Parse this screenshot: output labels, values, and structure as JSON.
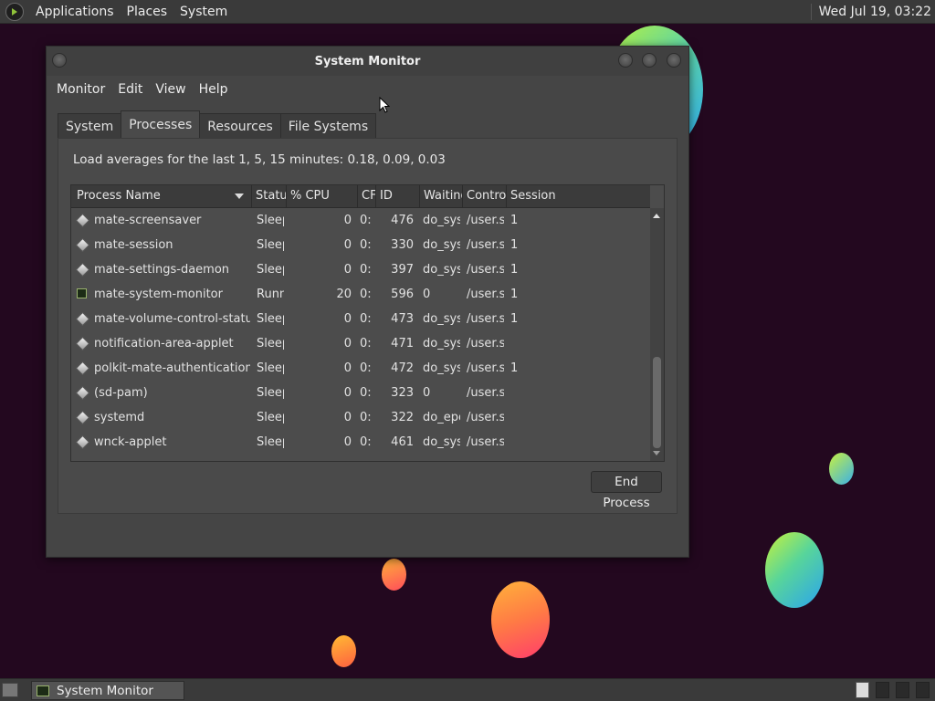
{
  "top_panel": {
    "menus": [
      "Applications",
      "Places",
      "System"
    ],
    "clock": "Wed Jul 19, 03:22"
  },
  "window": {
    "title": "System Monitor",
    "menus": [
      "Monitor",
      "Edit",
      "View",
      "Help"
    ],
    "tabs": [
      "System",
      "Processes",
      "Resources",
      "File Systems"
    ],
    "active_tab": "Processes",
    "load_averages": "Load averages for the last 1, 5, 15 minutes: 0.18, 0.09, 0.03",
    "columns": [
      "Process Name",
      "Statu",
      "% CPU",
      "CF",
      "ID",
      "Waiting",
      "Contro",
      "Session"
    ],
    "processes": [
      {
        "name": "mate-screensaver",
        "status": "Sleep",
        "cpu": "0",
        "cputime": "0:",
        "id": "476",
        "waiting": "do_sys",
        "control": "/user.s",
        "session": "1",
        "icon": "diamond-icon"
      },
      {
        "name": "mate-session",
        "status": "Sleep",
        "cpu": "0",
        "cputime": "0:",
        "id": "330",
        "waiting": "do_sys",
        "control": "/user.s",
        "session": "1",
        "icon": "diamond-icon"
      },
      {
        "name": "mate-settings-daemon",
        "status": "Sleep",
        "cpu": "0",
        "cputime": "0:",
        "id": "397",
        "waiting": "do_sys",
        "control": "/user.s",
        "session": "1",
        "icon": "diamond-icon"
      },
      {
        "name": "mate-system-monitor",
        "status": "Runn",
        "cpu": "20",
        "cputime": "0:",
        "id": "596",
        "waiting": "0",
        "control": "/user.s",
        "session": "1",
        "icon": "system-monitor-icon"
      },
      {
        "name": "mate-volume-control-status",
        "status": "Sleep",
        "cpu": "0",
        "cputime": "0:",
        "id": "473",
        "waiting": "do_sys",
        "control": "/user.s",
        "session": "1",
        "icon": "diamond-icon"
      },
      {
        "name": "notification-area-applet",
        "status": "Sleep",
        "cpu": "0",
        "cputime": "0:",
        "id": "471",
        "waiting": "do_sys",
        "control": "/user.s",
        "session": "",
        "icon": "diamond-icon"
      },
      {
        "name": "polkit-mate-authentication-",
        "status": "Sleep",
        "cpu": "0",
        "cputime": "0:",
        "id": "472",
        "waiting": "do_sys",
        "control": "/user.s",
        "session": "1",
        "icon": "diamond-icon"
      },
      {
        "name": "(sd-pam)",
        "status": "Sleep",
        "cpu": "0",
        "cputime": "0:",
        "id": "323",
        "waiting": "0",
        "control": "/user.s",
        "session": "",
        "icon": "diamond-icon"
      },
      {
        "name": "systemd",
        "status": "Sleep",
        "cpu": "0",
        "cputime": "0:",
        "id": "322",
        "waiting": "do_epo",
        "control": "/user.s",
        "session": "",
        "icon": "diamond-icon"
      },
      {
        "name": "wnck-applet",
        "status": "Sleep",
        "cpu": "0",
        "cputime": "0:",
        "id": "461",
        "waiting": "do_sys",
        "control": "/user.s",
        "session": "",
        "icon": "diamond-icon"
      }
    ],
    "end_process_label": "End Process"
  },
  "taskbar": {
    "items": [
      {
        "label": "System Monitor",
        "icon": "system-monitor-icon"
      }
    ]
  }
}
